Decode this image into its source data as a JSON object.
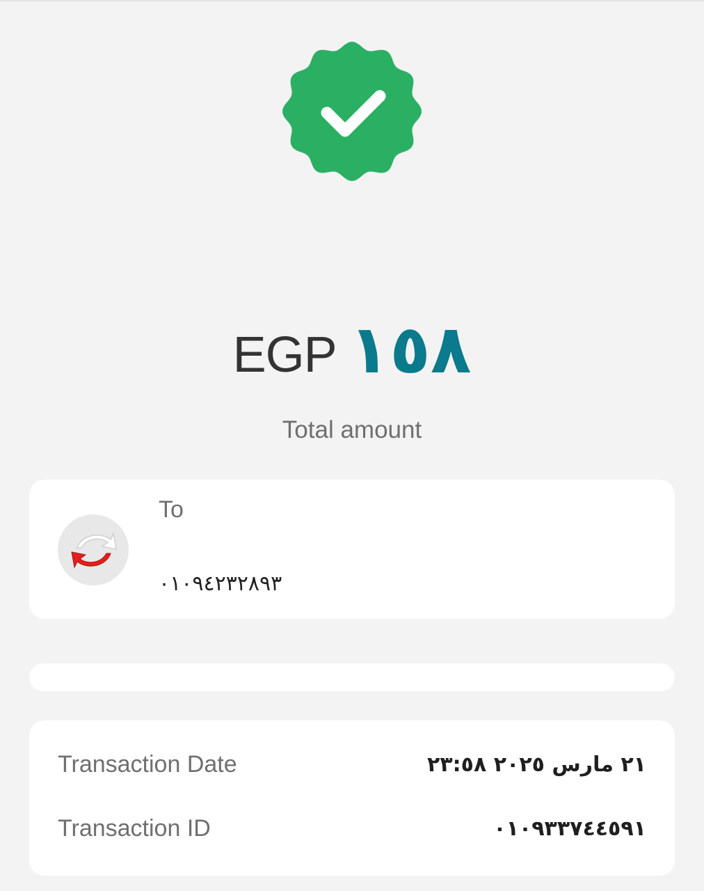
{
  "status": {
    "icon": "verified-check-badge-icon",
    "color": "#2bb063"
  },
  "amount": {
    "currency": "EGP",
    "value": "١٥٨",
    "label": "Total amount",
    "value_color": "#0a7a8c"
  },
  "recipient": {
    "label": "To",
    "number": "٠١٠٩٤٢٣٢٨٩٣",
    "avatar_icon": "transfer-arrows-icon"
  },
  "details": {
    "date_label": "Transaction Date",
    "date_value": "٢١ مارس ٢٠٢٥  ٢٣:٥٨",
    "id_label": "Transaction ID",
    "id_value": "٠١٠٩٣٣٧٤٤٥٩١"
  }
}
